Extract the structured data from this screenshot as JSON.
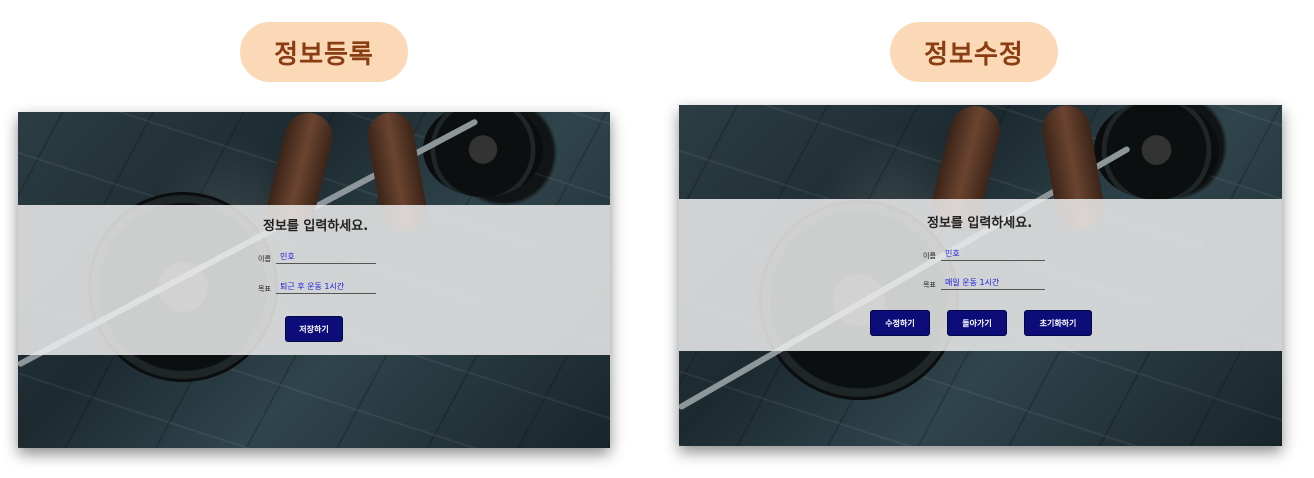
{
  "register": {
    "title": "정보등록",
    "prompt": "정보를 입력하세요.",
    "name_label": "이름",
    "name_value": "민호",
    "goal_label": "목표",
    "goal_value": "퇴근 후 운동 1시간",
    "save_button": "저장하기"
  },
  "edit": {
    "title": "정보수정",
    "prompt": "정보를 입력하세요.",
    "name_label": "이름",
    "name_value": "민호",
    "goal_label": "목표",
    "goal_value": "매일 운동 1시간",
    "edit_button": "수정하기",
    "back_button": "돌아가기",
    "reset_button": "초기화하기"
  },
  "colors": {
    "title_pill_bg": "#fbd9b6",
    "title_text": "#8a3d12",
    "button_bg": "#0d0d7a",
    "value_text": "#1a1ae0"
  }
}
